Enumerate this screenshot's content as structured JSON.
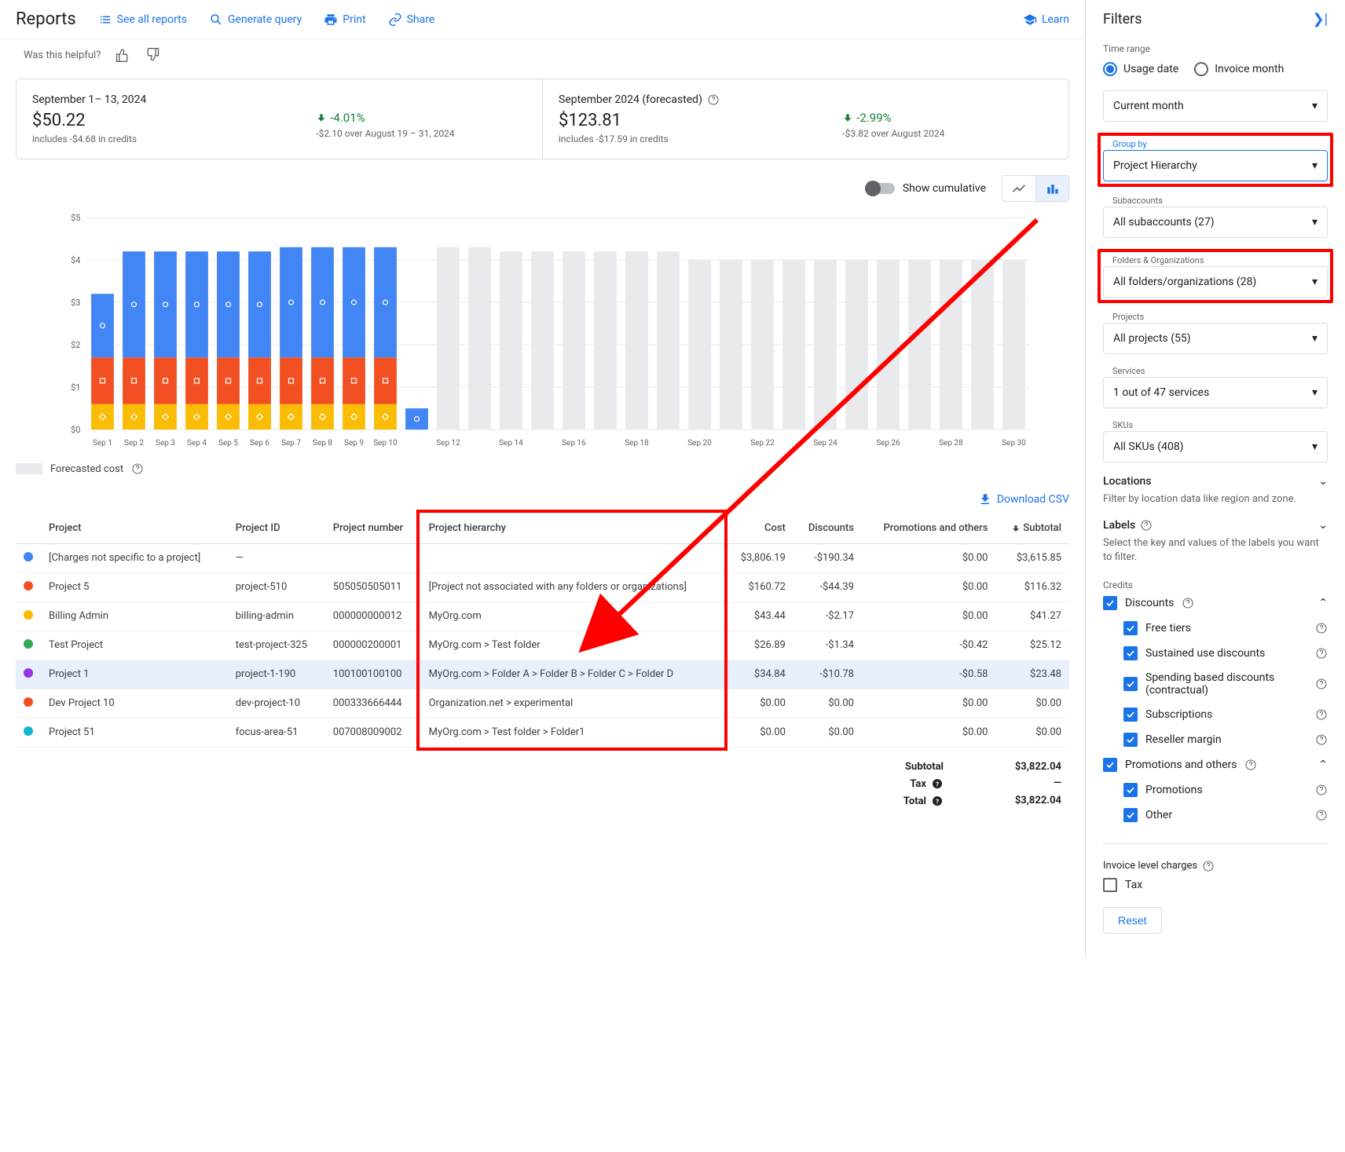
{
  "header": {
    "title": "Reports",
    "see_all": "See all reports",
    "generate": "Generate query",
    "print": "Print",
    "share": "Share",
    "learn": "Learn"
  },
  "helpful": {
    "text": "Was this helpful?"
  },
  "summary": {
    "left": {
      "title": "September 1– 13, 2024",
      "amount": "$50.22",
      "sub": "includes -$4.68 in credits",
      "pct": "-4.01%",
      "pct_sub": "-$2.10 over August 19 – 31, 2024"
    },
    "right": {
      "title": "September 2024 (forecasted)",
      "amount": "$123.81",
      "sub": "includes -$17.59 in credits",
      "pct": "-2.99%",
      "pct_sub": "-$3.82 over August 2024"
    }
  },
  "chart": {
    "cumulative_label": "Show cumulative",
    "forecast_label": "Forecasted cost"
  },
  "chart_data": {
    "type": "bar",
    "ylabel": "$",
    "ylim": [
      0,
      5
    ],
    "yticks": [
      "$0",
      "$1",
      "$2",
      "$3",
      "$4",
      "$5"
    ],
    "categories": [
      "Sep 1",
      "Sep 2",
      "Sep 3",
      "Sep 4",
      "Sep 5",
      "Sep 6",
      "Sep 7",
      "Sep 8",
      "Sep 9",
      "Sep 10",
      "Sep 12",
      "Sep 14",
      "Sep 16",
      "Sep 18",
      "Sep 20",
      "Sep 22",
      "Sep 24",
      "Sep 26",
      "Sep 28",
      "Sep 30"
    ],
    "actual_days": [
      "Sep 1",
      "Sep 2",
      "Sep 3",
      "Sep 4",
      "Sep 5",
      "Sep 6",
      "Sep 7",
      "Sep 8",
      "Sep 9",
      "Sep 10",
      "Sep 12"
    ],
    "series": [
      {
        "name": "yellow",
        "color": "#fbbc04",
        "values": [
          0.6,
          0.6,
          0.6,
          0.6,
          0.6,
          0.6,
          0.6,
          0.6,
          0.6,
          0.6,
          0
        ]
      },
      {
        "name": "orange",
        "color": "#f25022",
        "values": [
          1.1,
          1.1,
          1.1,
          1.1,
          1.1,
          1.1,
          1.1,
          1.1,
          1.1,
          1.1,
          0
        ]
      },
      {
        "name": "blue",
        "color": "#4285f4",
        "values": [
          1.5,
          2.5,
          2.5,
          2.5,
          2.5,
          2.5,
          2.6,
          2.6,
          2.6,
          2.6,
          0.5
        ]
      }
    ],
    "forecast_days": [
      "Sep 11",
      "Sep 13",
      "Sep 14",
      "Sep 15",
      "Sep 16",
      "Sep 17",
      "Sep 18",
      "Sep 19",
      "Sep 20",
      "Sep 21",
      "Sep 22",
      "Sep 23",
      "Sep 24",
      "Sep 25",
      "Sep 26",
      "Sep 27",
      "Sep 28",
      "Sep 29",
      "Sep 30"
    ],
    "forecast_values": [
      4.3,
      4.3,
      4.2,
      4.2,
      4.2,
      4.2,
      4.2,
      4.2,
      4.0,
      4.0,
      4.0,
      4.0,
      4.0,
      4.0,
      4.0,
      4.0,
      4.0,
      4.0,
      4.0
    ]
  },
  "download": {
    "label": "Download CSV"
  },
  "table": {
    "headers": {
      "project": "Project",
      "project_id": "Project ID",
      "project_number": "Project number",
      "hierarchy": "Project hierarchy",
      "cost": "Cost",
      "discounts": "Discounts",
      "promotions": "Promotions and others",
      "subtotal": "Subtotal"
    },
    "rows": [
      {
        "color": "#4285f4",
        "project": "[Charges not specific to a project]",
        "project_id": "—",
        "project_number": "",
        "hierarchy": "",
        "cost": "$3,806.19",
        "discounts": "-$190.34",
        "promotions": "$0.00",
        "subtotal": "$3,615.85",
        "hl": false
      },
      {
        "color": "#f25022",
        "project": "Project 5",
        "project_id": "project-510",
        "project_number": "505050505011",
        "hierarchy": "[Project not associated with any folders or organizations]",
        "cost": "$160.72",
        "discounts": "-$44.39",
        "promotions": "$0.00",
        "subtotal": "$116.32",
        "hl": false
      },
      {
        "color": "#fbbc04",
        "project": "Billing Admin",
        "project_id": "billing-admin",
        "project_number": "000000000012",
        "hierarchy": "MyOrg.com",
        "cost": "$43.44",
        "discounts": "-$2.17",
        "promotions": "$0.00",
        "subtotal": "$41.27",
        "hl": false
      },
      {
        "color": "#34a853",
        "project": "Test Project",
        "project_id": "test-project-325",
        "project_number": "000000200001",
        "hierarchy": "MyOrg.com > Test folder",
        "cost": "$26.89",
        "discounts": "-$1.34",
        "promotions": "-$0.42",
        "subtotal": "$25.12",
        "hl": false
      },
      {
        "color": "#9334e6",
        "project": "Project 1",
        "project_id": "project-1-190",
        "project_number": "100100100100",
        "hierarchy": "MyOrg.com > Folder A > Folder B > Folder C > Folder D",
        "cost": "$34.84",
        "discounts": "-$10.78",
        "promotions": "-$0.58",
        "subtotal": "$23.48",
        "hl": true
      },
      {
        "color": "#f25022",
        "project": "Dev Project 10",
        "project_id": "dev-project-10",
        "project_number": "000333666444",
        "hierarchy": "Organization.net > experimental",
        "cost": "$0.00",
        "discounts": "$0.00",
        "promotions": "$0.00",
        "subtotal": "$0.00",
        "hl": false
      },
      {
        "color": "#12b5cb",
        "project": "Project 51",
        "project_id": "focus-area-51",
        "project_number": "007008009002",
        "hierarchy": "MyOrg.com > Test folder > Folder1",
        "cost": "$0.00",
        "discounts": "$0.00",
        "promotions": "$0.00",
        "subtotal": "$0.00",
        "hl": false
      }
    ],
    "totals": {
      "subtotal_label": "Subtotal",
      "subtotal": "$3,822.04",
      "tax_label": "Tax",
      "tax": "—",
      "total_label": "Total",
      "total": "$3,822.04"
    }
  },
  "filters": {
    "title": "Filters",
    "time_range": "Time range",
    "usage_date": "Usage date",
    "invoice_month": "Invoice month",
    "current_month": "Current month",
    "group_by_label": "Group by",
    "group_by": "Project Hierarchy",
    "subaccounts_label": "Subaccounts",
    "subaccounts": "All subaccounts (27)",
    "folders_label": "Folders & Organizations",
    "folders": "All folders/organizations (28)",
    "projects_label": "Projects",
    "projects": "All projects (55)",
    "services_label": "Services",
    "services": "1 out of 47 services",
    "skus_label": "SKUs",
    "skus": "All SKUs (408)",
    "locations": "Locations",
    "locations_sub": "Filter by location data like region and zone.",
    "labels": "Labels",
    "labels_sub": "Select the key and values of the labels you want to filter.",
    "credits": "Credits",
    "discounts": "Discounts",
    "free_tiers": "Free tiers",
    "sustained": "Sustained use discounts",
    "spending": "Spending based discounts (contractual)",
    "subscriptions": "Subscriptions",
    "reseller": "Reseller margin",
    "promotions_hdr": "Promotions and others",
    "promotions": "Promotions",
    "other": "Other",
    "invoice_charges": "Invoice level charges",
    "tax": "Tax",
    "reset": "Reset"
  }
}
